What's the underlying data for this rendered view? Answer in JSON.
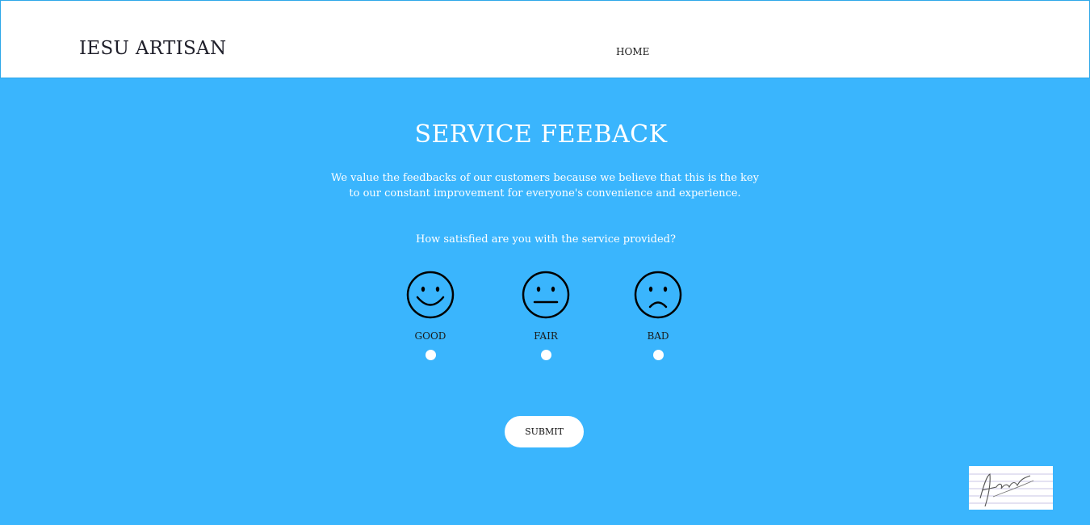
{
  "header": {
    "brand": "IESU ARTISAN",
    "nav": [
      {
        "label": "HOME"
      }
    ]
  },
  "main": {
    "title": "SERVICE FEEBACK",
    "intro": "We value the feedbacks of our customers because we believe that this is the key to our constant improvement for everyone's convenience and experience.",
    "question": "How satisfied are you with the service provided?",
    "options": [
      {
        "label": "GOOD",
        "icon": "smiley-happy-icon",
        "selected": false
      },
      {
        "label": "FAIR",
        "icon": "smiley-neutral-icon",
        "selected": false
      },
      {
        "label": "BAD",
        "icon": "smiley-sad-icon",
        "selected": false
      }
    ],
    "submit_label": "SUBMIT"
  },
  "colors": {
    "background": "#3ab5fd",
    "header_background": "#ffffff",
    "text_light": "#ffffff",
    "text_dark": "#1f1f2a"
  }
}
